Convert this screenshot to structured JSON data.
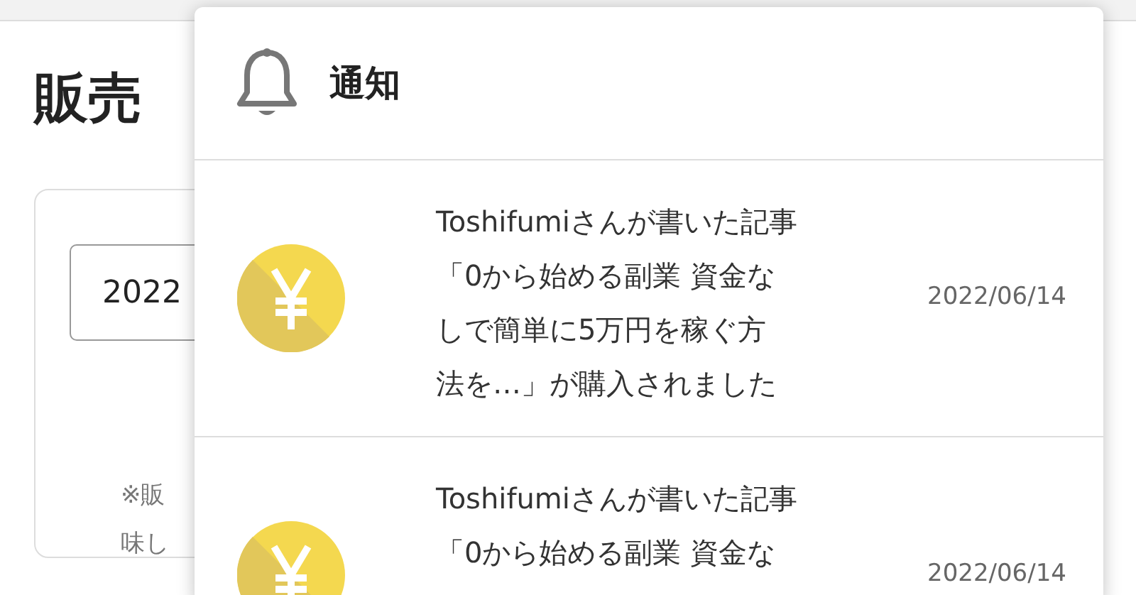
{
  "page": {
    "title": "販売",
    "date_field": {
      "value": "2022"
    },
    "note_lines": [
      "※販",
      "味し"
    ]
  },
  "notifications_panel": {
    "title": "通知",
    "items": [
      {
        "message_lines": [
          "Toshifumiさんが書いた記事",
          "「0から始める副業 資金な",
          "しで簡単に5万円を稼ぐ方",
          "法を…」が購入されました"
        ],
        "date": "2022/06/14"
      },
      {
        "message_lines": [
          "Toshifumiさんが書いた記事",
          "「0から始める副業 資金な"
        ],
        "date": "2022/06/14"
      }
    ]
  }
}
